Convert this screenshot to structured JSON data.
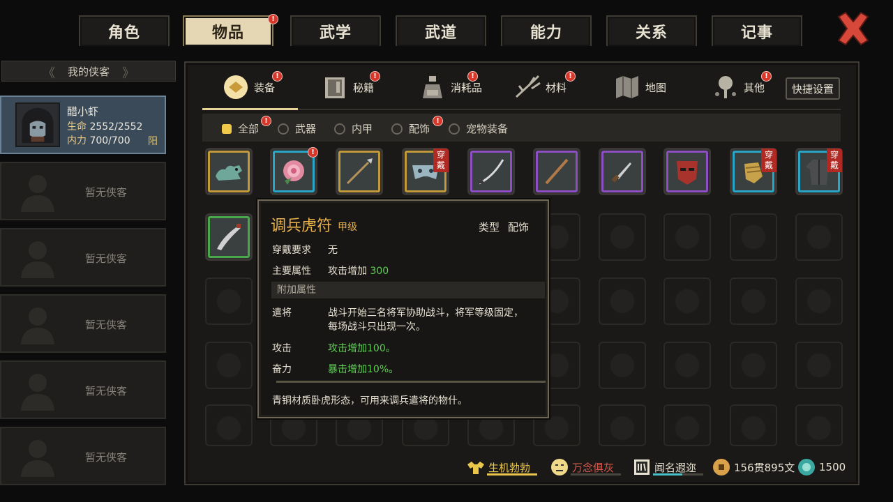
{
  "top_tabs": [
    {
      "label": "角色"
    },
    {
      "label": "物品"
    },
    {
      "label": "武学"
    },
    {
      "label": "武道"
    },
    {
      "label": "能力"
    },
    {
      "label": "关系"
    },
    {
      "label": "记事"
    }
  ],
  "party": {
    "header": "我的侠客",
    "hero": {
      "name": "醋小虾",
      "hp_label": "生命",
      "hp_value": "2552/2552",
      "mp_label": "内力",
      "mp_value": "700/700",
      "tag": "阳"
    },
    "empty_label": "暂无侠客"
  },
  "categories": [
    {
      "label": "装备",
      "icon": "equipment-icon"
    },
    {
      "label": "秘籍",
      "icon": "book-icon"
    },
    {
      "label": "消耗品",
      "icon": "potion-icon"
    },
    {
      "label": "材料",
      "icon": "material-icon"
    },
    {
      "label": "地图",
      "icon": "map-icon"
    },
    {
      "label": "其他",
      "icon": "other-icon"
    }
  ],
  "quick_settings": "快捷设置",
  "filters": [
    {
      "label": "全部",
      "selected": true
    },
    {
      "label": "武器",
      "selected": false
    },
    {
      "label": "内甲",
      "selected": false
    },
    {
      "label": "配饰",
      "selected": false
    },
    {
      "label": "宠物装备",
      "selected": false
    }
  ],
  "wear_label": "穿戴",
  "items": [
    {
      "name": "tiger-tally",
      "rarity": "gold",
      "worn": false
    },
    {
      "name": "peony-flower",
      "rarity": "blue",
      "worn": false
    },
    {
      "name": "spear",
      "rarity": "gold",
      "worn": false
    },
    {
      "name": "mask-ornament",
      "rarity": "gold",
      "worn": true
    },
    {
      "name": "curved-sword",
      "rarity": "purple",
      "worn": false
    },
    {
      "name": "staff",
      "rarity": "purple",
      "worn": false
    },
    {
      "name": "dagger",
      "rarity": "purple",
      "worn": false
    },
    {
      "name": "red-mask",
      "rarity": "purple",
      "worn": false
    },
    {
      "name": "gauntlet",
      "rarity": "blue",
      "worn": true
    },
    {
      "name": "robe",
      "rarity": "blue",
      "worn": true
    },
    {
      "name": "blade",
      "rarity": "green",
      "worn": false
    }
  ],
  "tooltip": {
    "name": "调兵虎符",
    "grade": "甲级",
    "type_key": "类型",
    "type_value": "配饰",
    "req_key": "穿戴要求",
    "req_value": "无",
    "main_key": "主要属性",
    "main_value_prefix": "攻击增加",
    "main_value_num": "300",
    "extra_header": "附加属性",
    "extras": [
      {
        "key": "遣将",
        "line1": "战斗开始三名将军协助战斗，将军等级固定，",
        "line2": "每场战斗只出现一次。"
      },
      {
        "key": "攻击",
        "line1": "攻击增加100。"
      },
      {
        "key": "奋力",
        "line1": "暴击增加10%。"
      }
    ],
    "description": "青铜材质卧虎形态，可用来调兵遣将的物什。"
  },
  "status": {
    "vitality": "生机勃勃",
    "mood": "万念俱灰",
    "fame": "闻名遐迩",
    "money": "156贯895文",
    "gems": "1500"
  },
  "colors": {
    "gold": "#c29a3a",
    "blue": "#2aa6c9",
    "purple": "#8e4ec4",
    "green": "#4aa84a",
    "badge": "#d8382c"
  }
}
